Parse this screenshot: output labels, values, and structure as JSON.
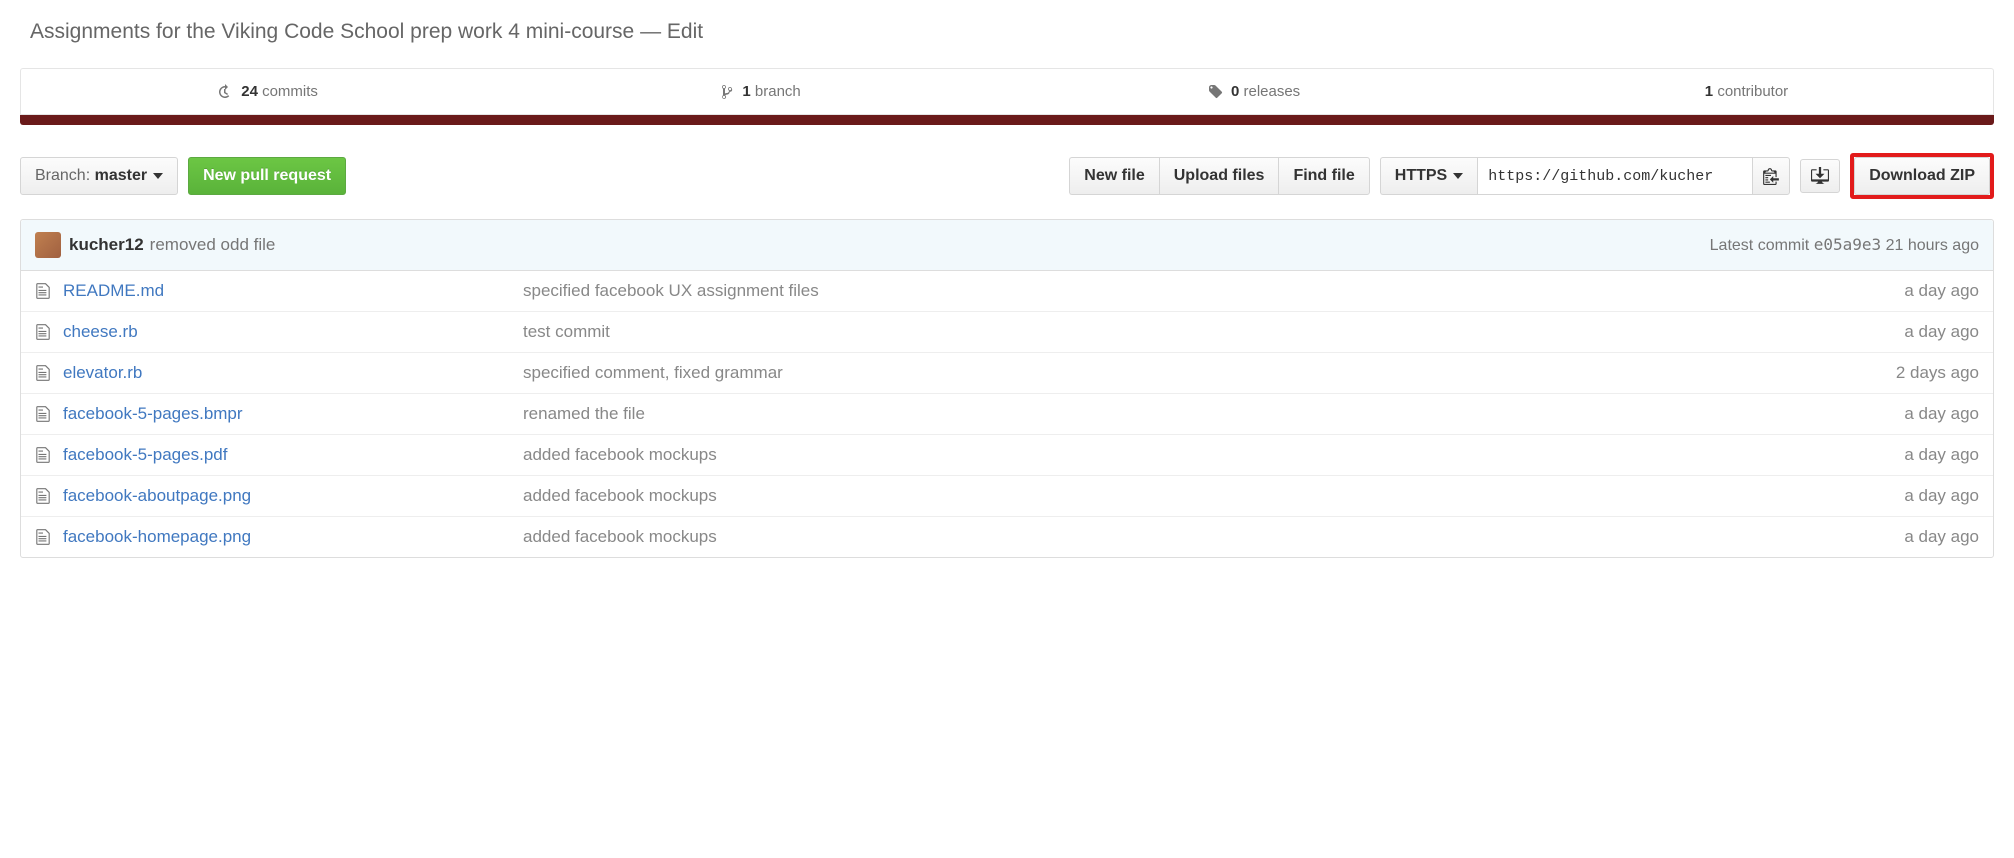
{
  "description": {
    "text": "Assignments for the Viking Code School prep work 4 mini-course",
    "edit_label": "Edit"
  },
  "stats": {
    "commits": {
      "count": "24",
      "label": "commits"
    },
    "branches": {
      "count": "1",
      "label": "branch"
    },
    "releases": {
      "count": "0",
      "label": "releases"
    },
    "contributors": {
      "count": "1",
      "label": "contributor"
    }
  },
  "toolbar": {
    "branch_prefix": "Branch:",
    "branch_name": "master",
    "new_pr": "New pull request",
    "new_file": "New file",
    "upload_files": "Upload files",
    "find_file": "Find file",
    "protocol": "HTTPS",
    "clone_url": "https://github.com/kucher",
    "download_zip": "Download ZIP"
  },
  "commit": {
    "author": "kucher12",
    "message": "removed odd file",
    "latest_label": "Latest commit",
    "sha": "e05a9e3",
    "when": "21 hours ago"
  },
  "files": [
    {
      "name": "README.md",
      "message": "specified facebook UX assignment files",
      "age": "a day ago"
    },
    {
      "name": "cheese.rb",
      "message": "test commit",
      "age": "a day ago"
    },
    {
      "name": "elevator.rb",
      "message": "specified comment, fixed grammar",
      "age": "2 days ago"
    },
    {
      "name": "facebook-5-pages.bmpr",
      "message": "renamed the file",
      "age": "a day ago"
    },
    {
      "name": "facebook-5-pages.pdf",
      "message": "added facebook mockups",
      "age": "a day ago"
    },
    {
      "name": "facebook-aboutpage.png",
      "message": "added facebook mockups",
      "age": "a day ago"
    },
    {
      "name": "facebook-homepage.png",
      "message": "added facebook mockups",
      "age": "a day ago"
    }
  ]
}
